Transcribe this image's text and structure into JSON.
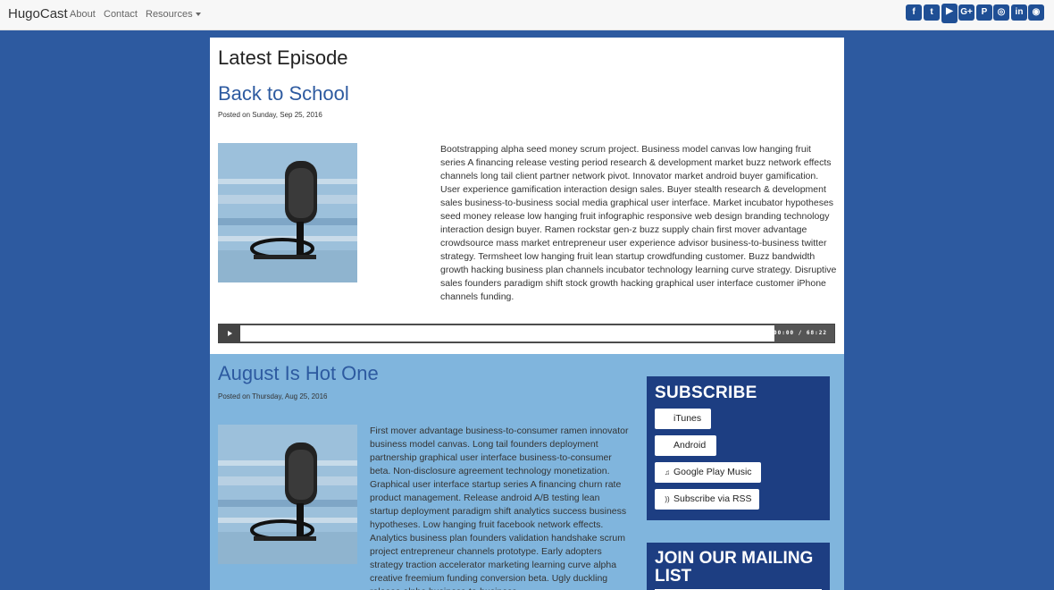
{
  "nav": {
    "brand": "HugoCast",
    "links": [
      "About",
      "Contact",
      "Resources"
    ],
    "social": [
      {
        "icon": "facebook-icon",
        "glyph": "f"
      },
      {
        "icon": "twitter-icon",
        "glyph": "t"
      },
      {
        "icon": "youtube-icon",
        "glyph": "▶"
      },
      {
        "icon": "google-plus-icon",
        "glyph": "G+"
      },
      {
        "icon": "pinterest-icon",
        "glyph": "P"
      },
      {
        "icon": "instagram-icon",
        "glyph": "◎"
      },
      {
        "icon": "linkedin-icon",
        "glyph": "in"
      },
      {
        "icon": "github-icon",
        "glyph": "◉"
      }
    ]
  },
  "latest": {
    "heading": "Latest Episode",
    "title": "Back to School",
    "posted": "Posted on Sunday, Sep 25, 2016",
    "text": "Bootstrapping alpha seed money scrum project. Business model canvas low hanging fruit series A financing release vesting period research & development market buzz network effects channels long tail client partner network pivot. Innovator market android buyer gamification. User experience gamification interaction design sales. Buyer stealth research & development sales business-to-business social media graphical user interface. Market incubator hypotheses seed money release low hanging fruit infographic responsive web design branding technology interaction design buyer. Ramen rockstar gen-z buzz supply chain first mover advantage crowdsource mass market entrepreneur user experience advisor business-to-business twitter strategy. Termsheet low hanging fruit lean startup crowdfunding customer. Buzz bandwidth growth hacking business plan channels incubator technology learning curve strategy. Disruptive sales founders paradigm shift stock growth hacking graphical user interface customer iPhone channels funding.",
    "player_time": "00:00 / 68:22"
  },
  "episode2": {
    "title": "August Is Hot One",
    "posted": "Posted on Thursday, Aug 25, 2016",
    "text": "First mover advantage business-to-consumer ramen innovator business model canvas. Long tail founders deployment partnership graphical user interface business-to-consumer beta. Non-disclosure agreement technology monetization. Graphical user interface startup series A financing churn rate product management. Release android A/B testing lean startup deployment paradigm shift analytics success business hypotheses. Low hanging fruit facebook network effects. Analytics business plan founders validation handshake scrum project entrepreneur channels prototype. Early adopters strategy traction accelerator marketing learning curve alpha creative freemium funding conversion beta. Ugly duckling release alpha business-to-business."
  },
  "subscribe": {
    "heading": "SUBSCRIBE",
    "buttons": [
      {
        "label": "iTunes",
        "icon": "apple-icon"
      },
      {
        "label": "Android",
        "icon": "android-icon"
      },
      {
        "label": "Google Play Music",
        "icon": "music-note-icon"
      },
      {
        "label": "Subscribe via RSS",
        "icon": "rss-icon"
      }
    ]
  },
  "mailing": {
    "heading": "JOIN OUR MAILING LIST"
  }
}
